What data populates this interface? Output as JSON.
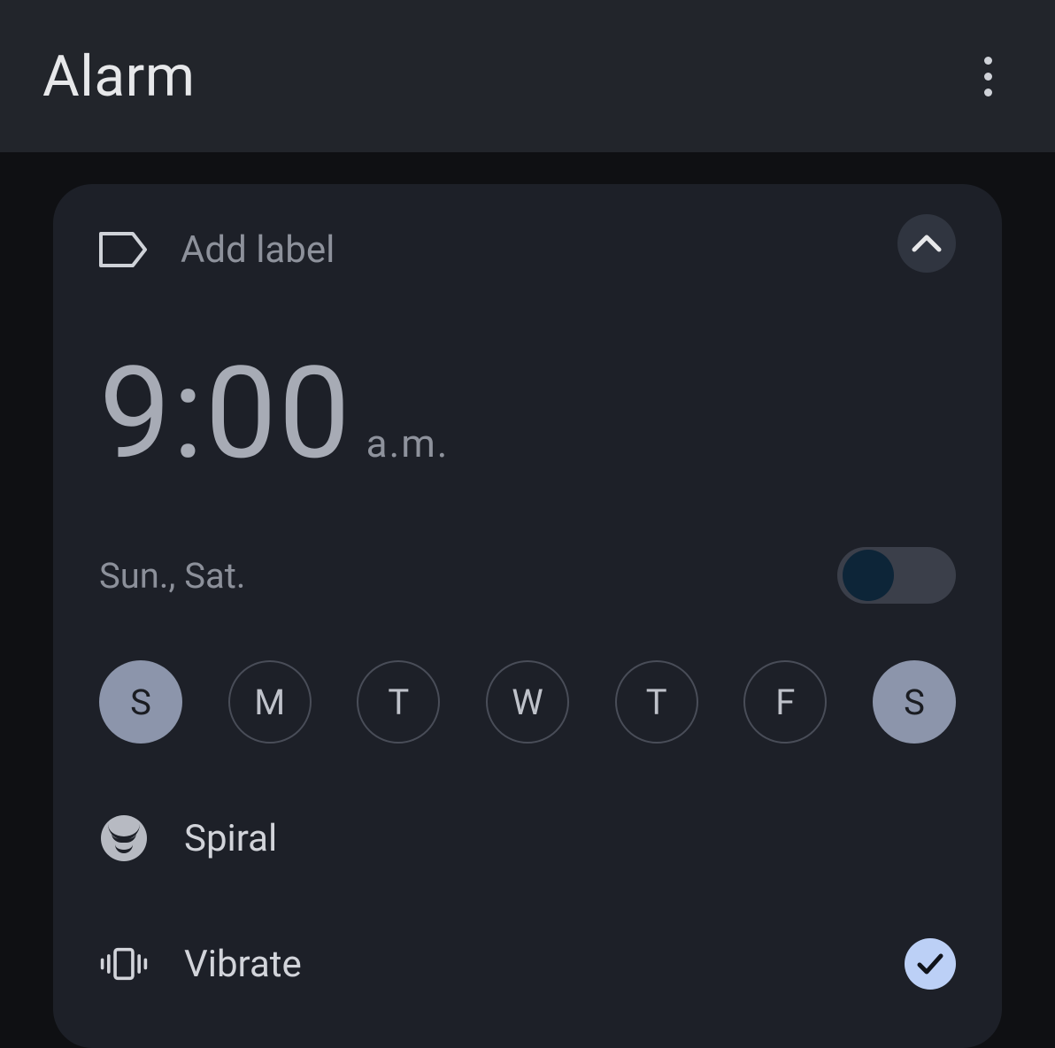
{
  "header": {
    "title": "Alarm"
  },
  "alarm": {
    "label_placeholder": "Add label",
    "time": "9:00",
    "ampm": "a.m.",
    "schedule_summary": "Sun., Sat.",
    "enabled": false,
    "days": [
      {
        "letter": "S",
        "selected": true
      },
      {
        "letter": "M",
        "selected": false
      },
      {
        "letter": "T",
        "selected": false
      },
      {
        "letter": "W",
        "selected": false
      },
      {
        "letter": "T",
        "selected": false
      },
      {
        "letter": "F",
        "selected": false
      },
      {
        "letter": "S",
        "selected": true
      }
    ],
    "sound_name": "Spiral",
    "vibrate_label": "Vibrate",
    "vibrate_checked": true
  },
  "colors": {
    "appbar_bg": "#22252b",
    "page_bg": "#0f1013",
    "card_bg": "#1d2028",
    "chip_on_bg": "#8c95ab",
    "check_bg": "#bcd0f6"
  }
}
